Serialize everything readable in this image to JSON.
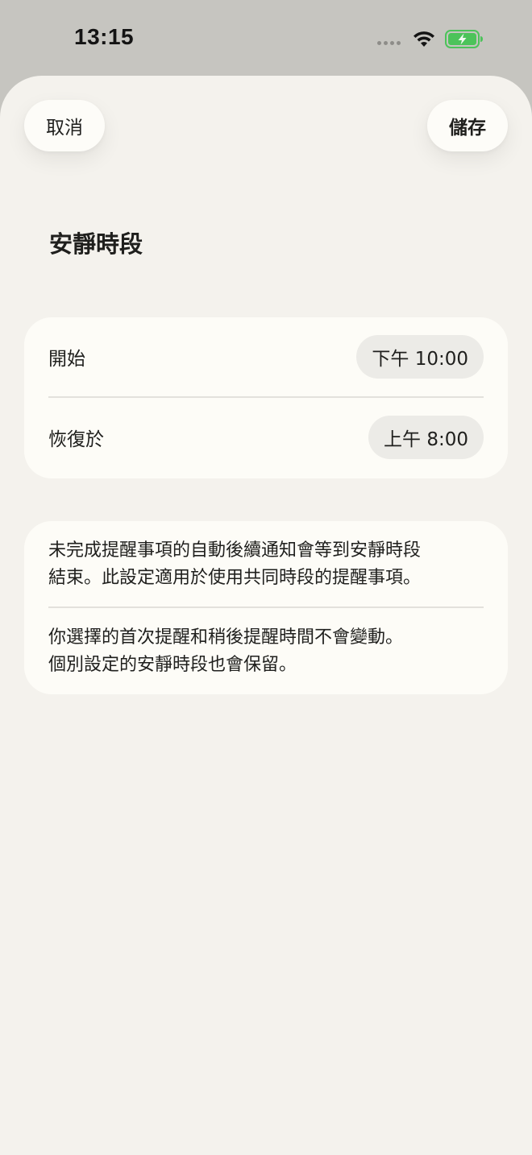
{
  "status_bar": {
    "time": "13:15"
  },
  "header": {
    "cancel_label": "取消",
    "save_label": "儲存"
  },
  "page": {
    "title": "安靜時段"
  },
  "schedule": {
    "start_label": "開始",
    "start_value": "下午 10:00",
    "resume_label": "恢復於",
    "resume_value": "上午 8:00"
  },
  "info": {
    "paragraph_1_line_1": "未完成提醒事項的自動後續通知會等到安靜時段",
    "paragraph_1_line_2": "結束。此設定適用於使用共同時段的提醒事項。",
    "paragraph_2_line_1": "你選擇的首次提醒和稍後提醒時間不會變動。",
    "paragraph_2_line_2": "個別設定的安靜時段也會保留。"
  },
  "colors": {
    "status_bar_bg": "#c6c5c0",
    "sheet_bg": "#f4f2ed",
    "card_bg": "#fdfcf7",
    "chip_bg": "#ecebe7",
    "battery_green": "#4cc35a"
  },
  "icons": {
    "wifi": "wifi-icon",
    "battery": "battery-charging-icon",
    "signal": "signal-dots-icon"
  }
}
